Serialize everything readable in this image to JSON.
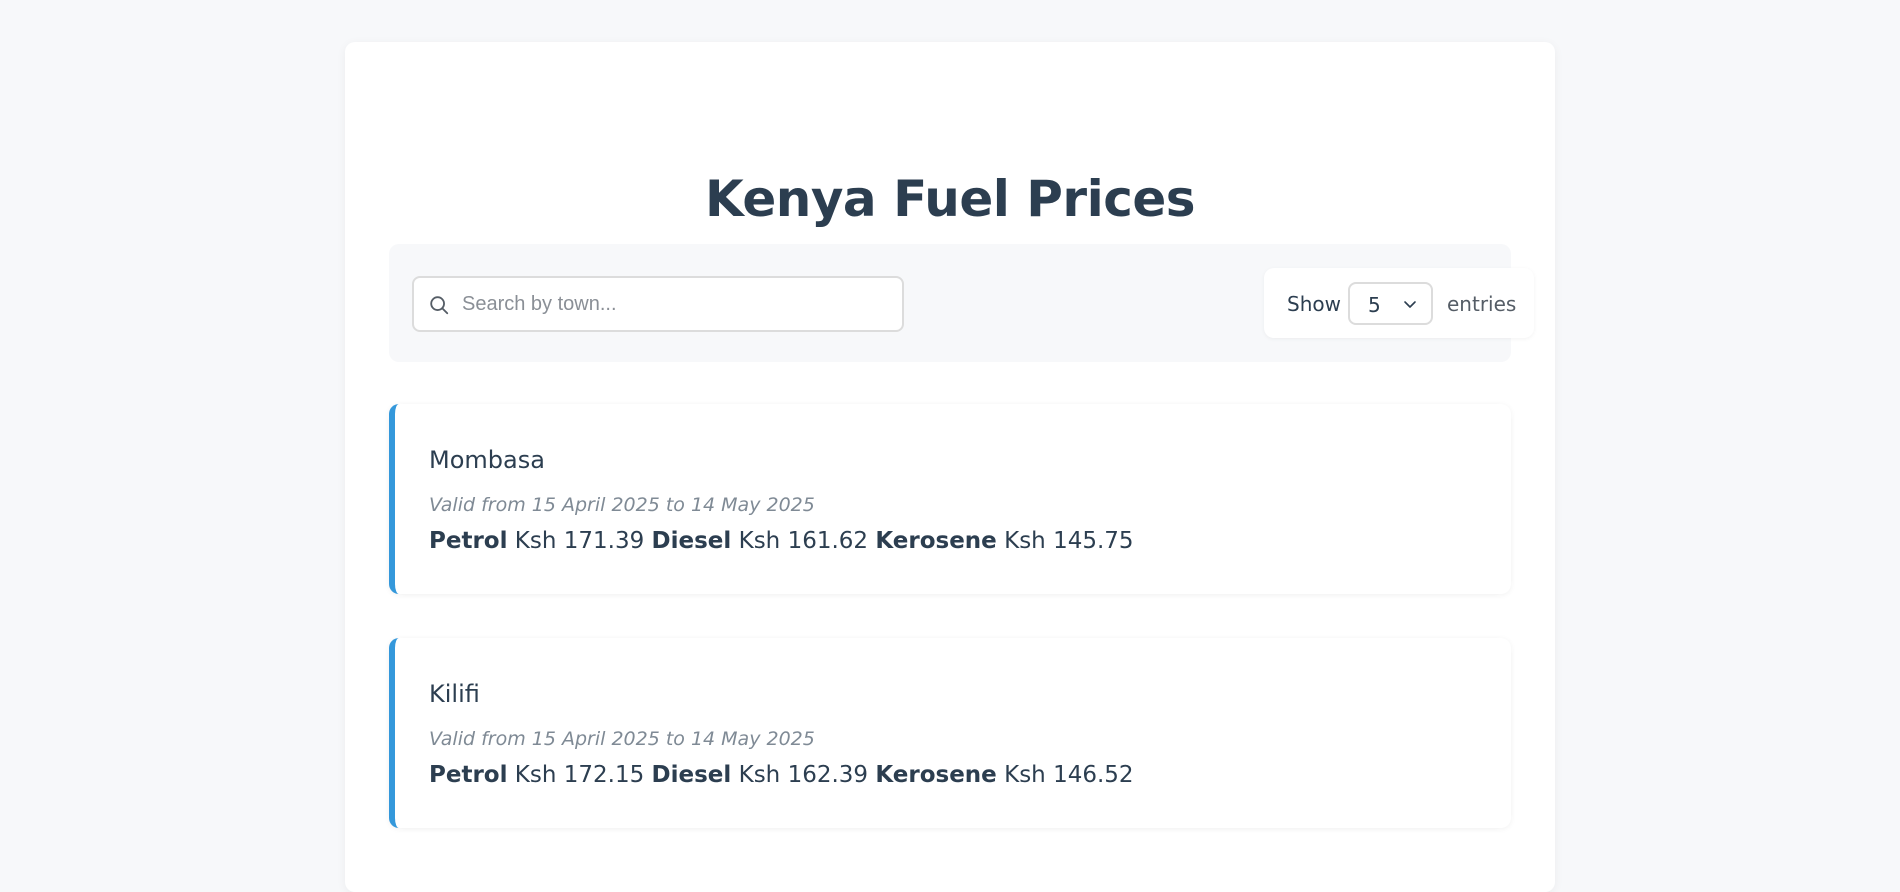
{
  "header": {
    "title": "Kenya Fuel Prices"
  },
  "controls": {
    "search": {
      "placeholder": "Search by town...",
      "value": "",
      "icon": "search-icon"
    },
    "entries": {
      "show_label": "Show",
      "selected": "5",
      "entries_label": "entries",
      "icon": "chevron-down-icon"
    }
  },
  "accent_color": "#3498db",
  "fuel_labels": {
    "petrol": "Petrol",
    "diesel": "Diesel",
    "kerosene": "Kerosene"
  },
  "towns": [
    {
      "name": "Mombasa",
      "validity": "Valid from 15 April 2025 to 14 May 2025",
      "petrol": "Ksh 171.39",
      "diesel": "Ksh 161.62",
      "kerosene": "Ksh 145.75"
    },
    {
      "name": "Kilifi",
      "validity": "Valid from 15 April 2025 to 14 May 2025",
      "petrol": "Ksh 172.15",
      "diesel": "Ksh 162.39",
      "kerosene": "Ksh 146.52"
    }
  ]
}
